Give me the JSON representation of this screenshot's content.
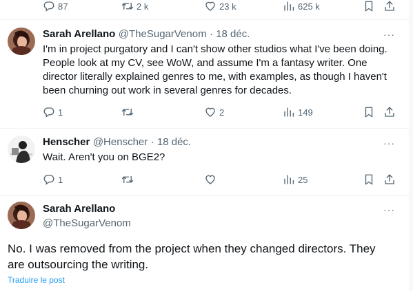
{
  "top_actions": {
    "replies": "87",
    "reposts": "2 k",
    "likes": "23 k",
    "views": "625 k"
  },
  "tweet1": {
    "name": "Sarah Arellano",
    "handle": "@TheSugarVenom",
    "date": "· 18 déc.",
    "text": "I'm in project purgatory and I can't show other studios what I've been doing. People look at my CV, see WoW, and assume I'm a fantasy writer. One director literally explained genres to me, with examples, as though I haven't been churning out work in several genres for decades.",
    "replies": "1",
    "reposts": "",
    "likes": "2",
    "views": "149"
  },
  "tweet2": {
    "name": "Henscher",
    "handle": "@Henscher",
    "date": "· 18 déc.",
    "text": "Wait. Aren't you on BGE2?",
    "replies": "1",
    "reposts": "",
    "likes": "",
    "views": "25"
  },
  "tweet3": {
    "name": "Sarah Arellano",
    "handle": "@TheSugarVenom",
    "text": "No. I was removed from the project when they changed directors. They are outsourcing the writing.",
    "translate_link": "Traduire le post"
  },
  "more_label": "···",
  "icons": [
    "reply-icon",
    "repost-icon",
    "like-icon",
    "views-icon",
    "bookmark-icon",
    "share-icon",
    "more-icon"
  ],
  "colors": {
    "text": "#0f1419",
    "secondary": "#536471",
    "link": "#1d9bf0",
    "divider": "#eff3f4"
  }
}
